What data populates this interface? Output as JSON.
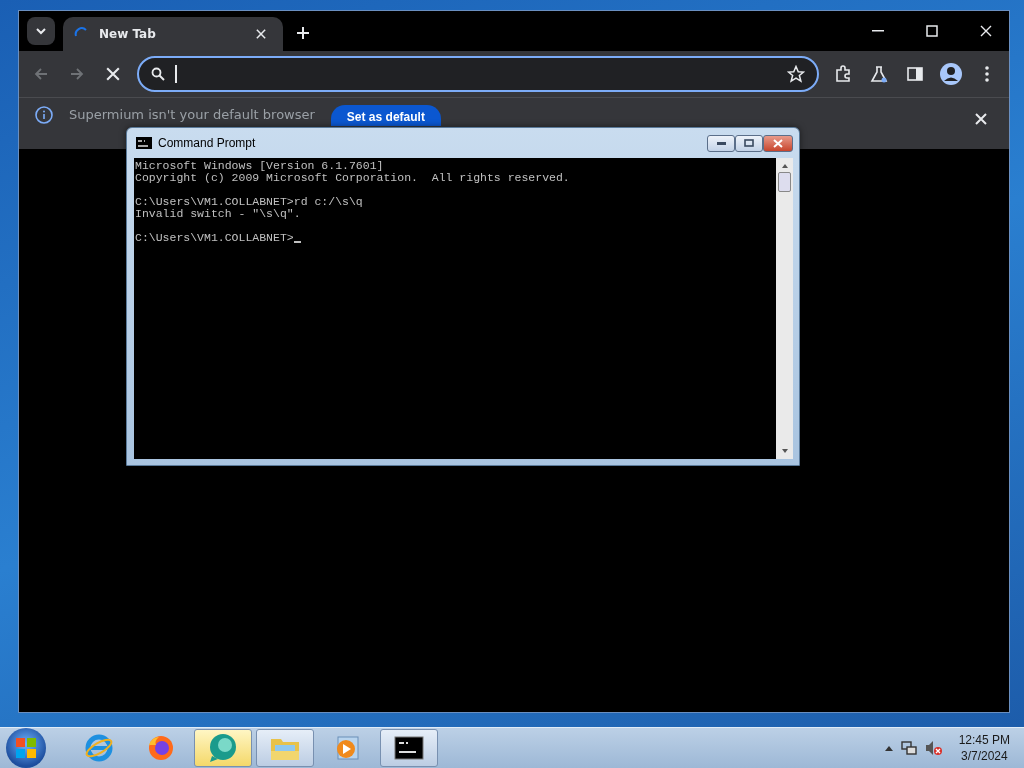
{
  "browser": {
    "tabs": [
      {
        "title": "New Tab",
        "selected": true,
        "loading": true
      }
    ],
    "address": {
      "focused": true
    },
    "infobar": {
      "message": "Supermium isn't your default browser",
      "button": "Set as default"
    }
  },
  "cmd": {
    "title": "Command Prompt",
    "blocks": [
      [
        "Microsoft Windows [Version 6.1.7601]",
        "Copyright (c) 2009 Microsoft Corporation.  All rights reserved."
      ],
      [
        "C:\\Users\\VM1.COLLABNET>rd c:/\\s\\q",
        "Invalid switch - \"\\s\\q\"."
      ],
      [
        "C:\\Users\\VM1.COLLABNET>"
      ]
    ],
    "cursor": true
  },
  "taskbar": {
    "apps": [
      {
        "kind": "ie",
        "open": false,
        "flashing": false
      },
      {
        "kind": "firefox",
        "open": false,
        "flashing": false
      },
      {
        "kind": "bubble",
        "open": true,
        "flashing": true
      },
      {
        "kind": "folder",
        "open": true,
        "flashing": false
      },
      {
        "kind": "media",
        "open": false,
        "flashing": false
      },
      {
        "kind": "console",
        "open": true,
        "flashing": false
      }
    ],
    "clock": {
      "time": "12:45 PM",
      "date": "3/7/2024"
    }
  }
}
